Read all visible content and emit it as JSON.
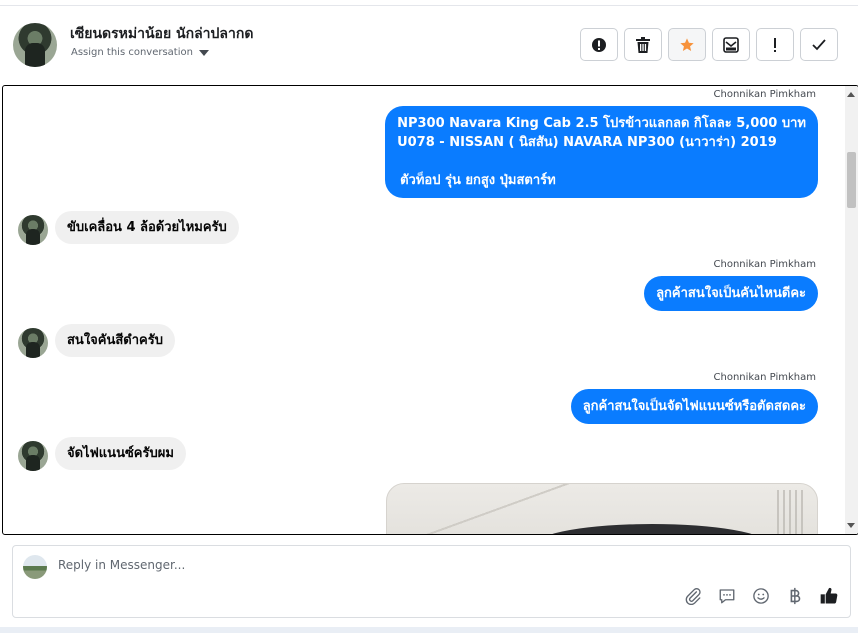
{
  "header": {
    "name": "เซียนดรหม่าน้อย นักล่าปลากด",
    "assign_label": "Assign this conversation",
    "actions": [
      {
        "name": "report-icon"
      },
      {
        "name": "trash-icon"
      },
      {
        "name": "star-icon"
      },
      {
        "name": "mark-unread-icon"
      },
      {
        "name": "exclamation-icon"
      },
      {
        "name": "check-icon"
      }
    ]
  },
  "conversation": {
    "messages": [
      {
        "direction": "out",
        "sender": "Chonnikan Pimkham",
        "lines": [
          "NP300 Navara King Cab 2.5 โปรข้าวแลกลด กิโลละ 5,000 บาท",
          "U078 - NISSAN ( นิสสัน) NAVARA NP300 (นาวาร่า) 2019",
          "",
          "ตัวท็อป รุ่น ยกสูง ปุ่มสตาร์ท"
        ]
      },
      {
        "direction": "in",
        "text": "ขับเคลื่อน 4 ล้อด้วยไหมครับ"
      },
      {
        "direction": "out",
        "sender": "Chonnikan Pimkham",
        "text": "ลูกค้าสนใจเป็นคันไหนดีคะ"
      },
      {
        "direction": "in",
        "text": "สนใจคันสีดำครับ"
      },
      {
        "direction": "out",
        "sender": "Chonnikan Pimkham",
        "text": "ลูกค้าสนใจเป็นจัดไฟแนนซ์หรือตัดสดคะ"
      },
      {
        "direction": "in",
        "text": "จัดไฟแนนซ์ครับผม"
      },
      {
        "direction": "out",
        "type": "photo"
      }
    ]
  },
  "reply": {
    "placeholder": "Reply in Messenger...",
    "tools": [
      "attachment-icon",
      "saved-reply-icon",
      "emoji-icon",
      "baht-icon",
      "like-icon"
    ]
  },
  "colors": {
    "outgoing_bubble": "#0a7cff",
    "incoming_bubble": "#f0f0f0",
    "star": "#f7923b"
  }
}
